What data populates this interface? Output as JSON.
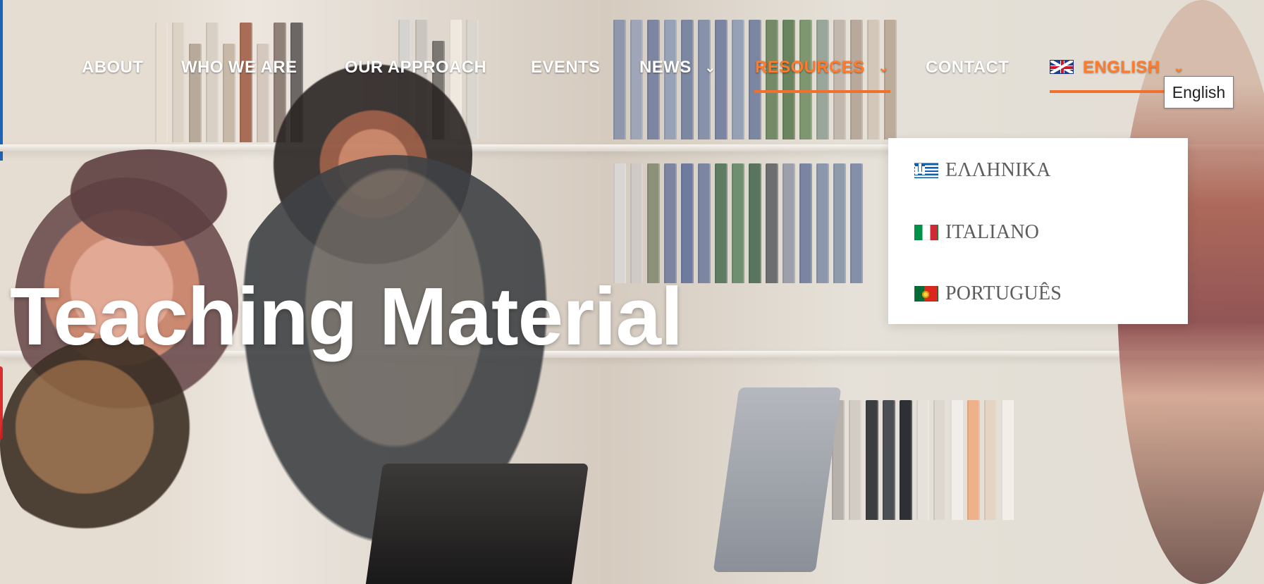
{
  "nav": {
    "items": [
      {
        "label": "ABOUT"
      },
      {
        "label": "WHO WE ARE"
      },
      {
        "label": "OUR APPROACH"
      },
      {
        "label": "EVENTS"
      },
      {
        "label": "NEWS",
        "has_dropdown": true
      },
      {
        "label": "RESOURCES",
        "has_dropdown": true,
        "active": true
      },
      {
        "label": "CONTACT"
      },
      {
        "label": "ENGLISH",
        "has_dropdown": true,
        "active": true,
        "icon": "uk-flag-icon"
      }
    ]
  },
  "tooltip": {
    "text": "English"
  },
  "language_menu": {
    "items": [
      {
        "label": "ΕΛΛΗΝΙΚΑ",
        "icon": "greece-flag-icon"
      },
      {
        "label": "ITALIANO",
        "icon": "italy-flag-icon"
      },
      {
        "label": "PORTUGUÊS",
        "icon": "portugal-flag-icon"
      }
    ]
  },
  "hero": {
    "title": "Teaching Material"
  },
  "colors": {
    "accent": "#f0702e",
    "nav_text": "#ffffff",
    "menu_text": "#5d5d5d",
    "tooltip_border": "#7f7f7f"
  }
}
